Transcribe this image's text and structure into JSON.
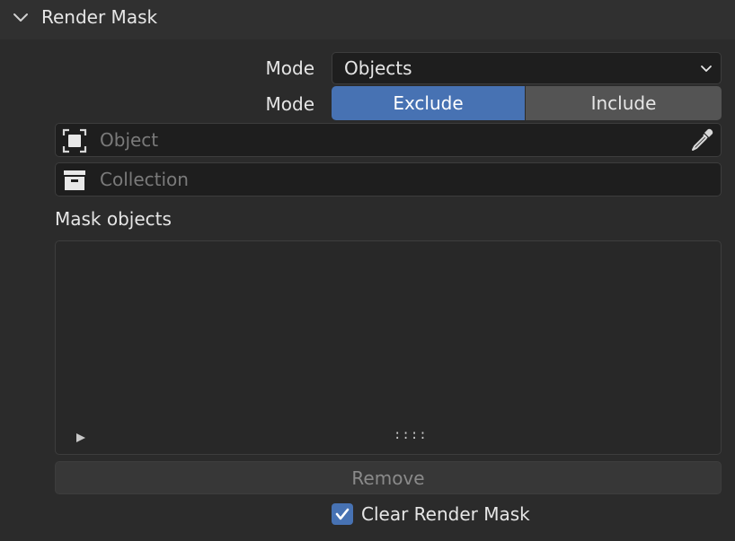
{
  "panel": {
    "title": "Render Mask",
    "collapse_icon": "chevron-down-icon"
  },
  "mode_row_1": {
    "label": "Mode",
    "value": "Objects",
    "arrow_icon": "chevron-down-icon"
  },
  "mode_row_2": {
    "label": "Mode",
    "options": [
      "Exclude",
      "Include"
    ],
    "selected": "Exclude"
  },
  "object_field": {
    "placeholder": "Object",
    "icon": "object-icon",
    "picker_icon": "eyedropper-icon"
  },
  "collection_field": {
    "placeholder": "Collection",
    "icon": "collection-icon"
  },
  "mask_objects": {
    "label": "Mask objects",
    "items": [],
    "expand_icon": "expand-triangle-icon",
    "grip": "::::"
  },
  "remove_button": {
    "label": "Remove"
  },
  "clear_render_mask": {
    "label": "Clear Render Mask",
    "checked": true
  },
  "colors": {
    "accent": "#4772b3",
    "panel_bg": "#303030",
    "body_bg": "#2b2b2b",
    "field_bg": "#1e1e1e"
  }
}
